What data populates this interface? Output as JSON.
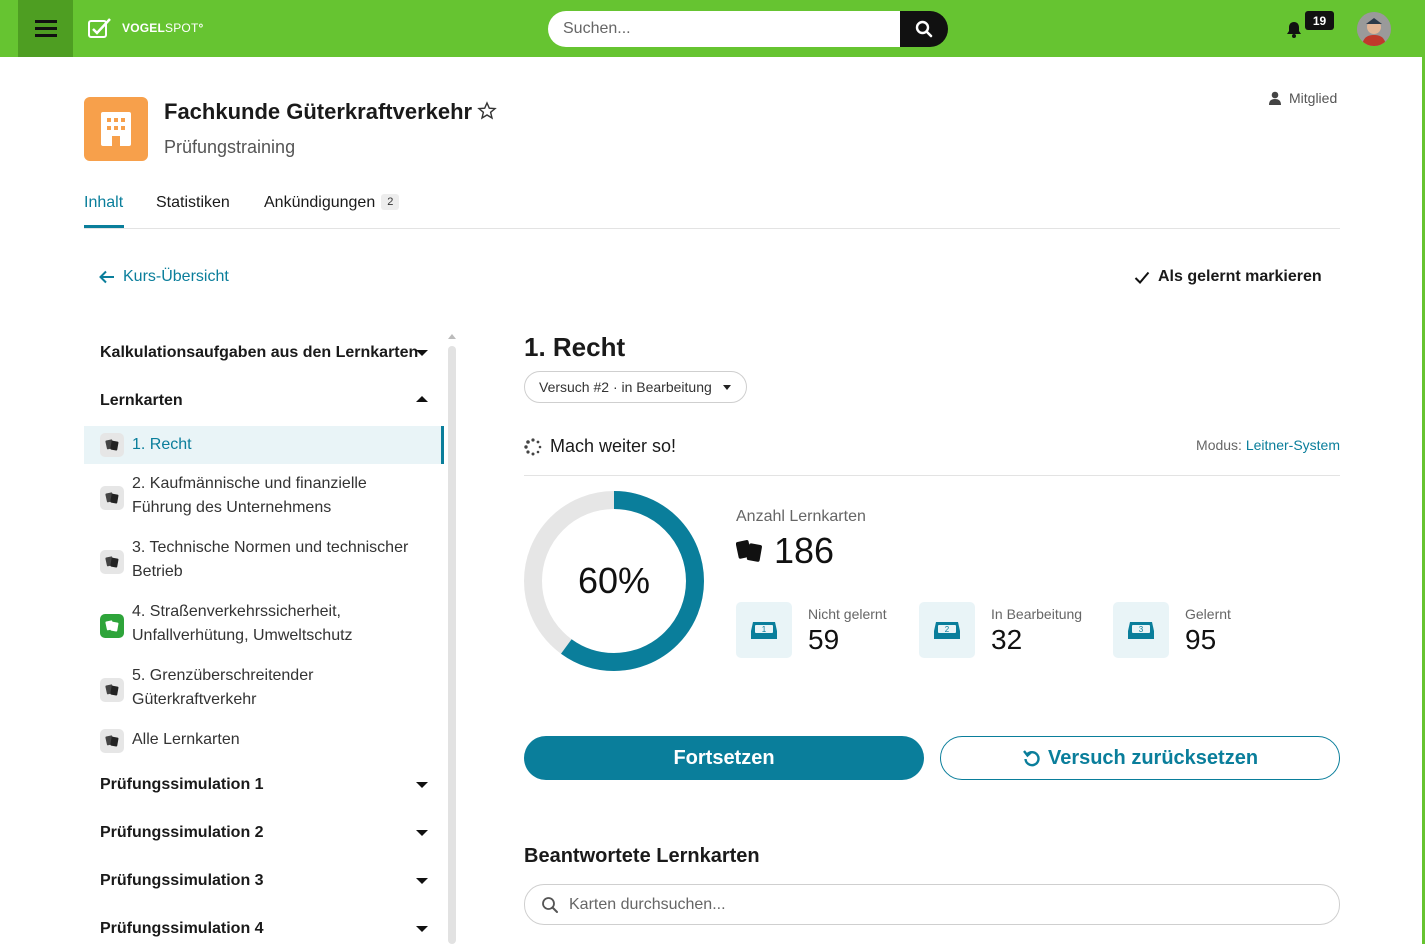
{
  "topbar": {
    "logo_strong": "VOGEL",
    "logo_thin": "SPOT",
    "search_placeholder": "Suchen...",
    "notification_count": "19"
  },
  "course": {
    "title": "Fachkunde Güterkraftverkehr",
    "subtitle": "Prüfungstraining",
    "role": "Mitglied"
  },
  "tabs": [
    {
      "label": "Inhalt"
    },
    {
      "label": "Statistiken"
    },
    {
      "label": "Ankündigungen",
      "count": "2"
    }
  ],
  "nav": {
    "back_label": "Kurs-Übersicht",
    "mark_label": "Als gelernt markieren"
  },
  "sidebar": {
    "sections": [
      {
        "label": "Kalkulationsaufgaben aus den Lernkarten"
      },
      {
        "label": "Lernkarten"
      },
      {
        "label": "Prüfungssimulation 1"
      },
      {
        "label": "Prüfungssimulation 2"
      },
      {
        "label": "Prüfungssimulation 3"
      },
      {
        "label": "Prüfungssimulation 4"
      }
    ],
    "items": [
      {
        "line1": "1. Recht",
        "line2": ""
      },
      {
        "line1": "2. Kaufmännische und finanzielle",
        "line2": "Führung des Unternehmens"
      },
      {
        "line1": "3. Technische Normen und technischer",
        "line2": "Betrieb"
      },
      {
        "line1": "4. Straßenverkehrssicherheit,",
        "line2": "Unfallverhütung, Umweltschutz"
      },
      {
        "line1": "5. Grenzüberschreitender",
        "line2": "Güterkraftverkehr"
      },
      {
        "line1": "Alle Lernkarten",
        "line2": ""
      }
    ]
  },
  "main": {
    "title": "1. Recht",
    "attempt": "Versuch #2 · in Bearbeitung",
    "status": "Mach weiter so!",
    "mode_label": "Modus:",
    "mode_value": "Leitner-System",
    "progress_label": "60%",
    "progress_fraction": 0.6,
    "count_label": "Anzahl Lernkarten",
    "count_value": "186",
    "stats": [
      {
        "box": "1",
        "label": "Nicht gelernt",
        "value": "59"
      },
      {
        "box": "2",
        "label": "In Bearbeitung",
        "value": "32"
      },
      {
        "box": "3",
        "label": "Gelernt",
        "value": "95"
      }
    ],
    "continue_label": "Fortsetzen",
    "reset_label": "Versuch zurücksetzen",
    "answered_title": "Beantwortete Lernkarten",
    "card_search_placeholder": "Karten durchsuchen..."
  },
  "colors": {
    "brand_green": "#66c431",
    "accent_teal": "#0a7e9b",
    "course_orange": "#f7a04b"
  }
}
